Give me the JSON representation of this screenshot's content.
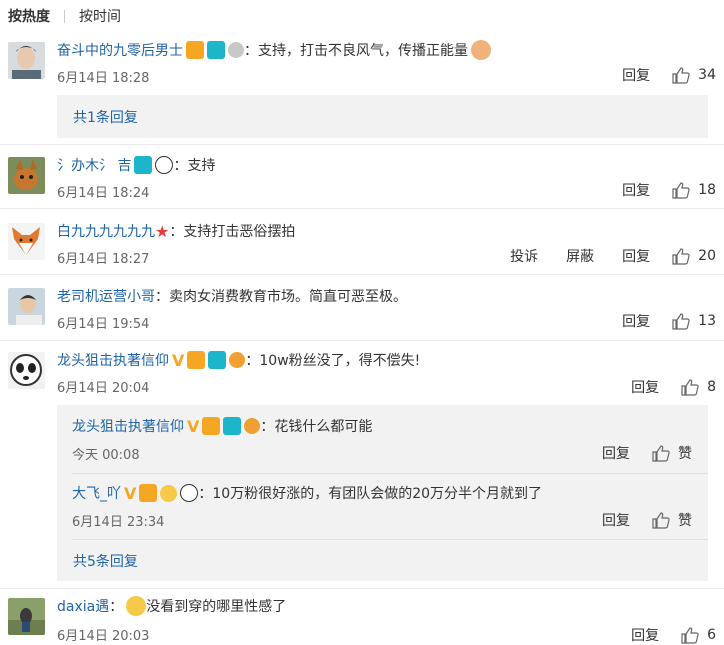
{
  "tabs": {
    "hot": "按热度",
    "time": "按时间"
  },
  "comments": [
    {
      "user": "奋斗中的九零后男士",
      "text": "支持，打击不良风气，传播正能量",
      "date": "6月14日 18:28",
      "reply": "回复",
      "likes": "34",
      "more": "共1条回复"
    },
    {
      "user": "氵办木氵 吉",
      "text": "支持",
      "date": "6月14日 18:24",
      "reply": "回复",
      "likes": "18"
    },
    {
      "user": "白九九九九九九",
      "text": "支持打击恶俗摆拍",
      "date": "6月14日 18:27",
      "report": "投诉",
      "block": "屏蔽",
      "reply": "回复",
      "likes": "20"
    },
    {
      "user": "老司机运营小哥",
      "text": "卖肉女消费教育市场。简直可恶至极。",
      "date": "6月14日 19:54",
      "reply": "回复",
      "likes": "13"
    },
    {
      "user": "龙头狙击执著信仰",
      "text": "10w粉丝没了，得不偿失!",
      "date": "6月14日 20:04",
      "reply": "回复",
      "likes": "8",
      "more": "共5条回复",
      "subs": [
        {
          "user": "龙头狙击执著信仰",
          "text": "花钱什么都可能",
          "date": "今天 00:08",
          "reply": "回复",
          "like": "赞"
        },
        {
          "user": "大飞_吖",
          "text": "10万粉很好涨的，有团队会做的20万分半个月就到了",
          "date": "6月14日 23:34",
          "reply": "回复",
          "like": "赞"
        }
      ]
    },
    {
      "user": "daxia遇",
      "text": "没看到穿的哪里性感了",
      "date": "6月14日 20:03",
      "reply": "回复",
      "likes": "6"
    }
  ],
  "colon": "：",
  "colors": {
    "link": "#1f63a8",
    "reply_bg": "#f2f2f2"
  }
}
